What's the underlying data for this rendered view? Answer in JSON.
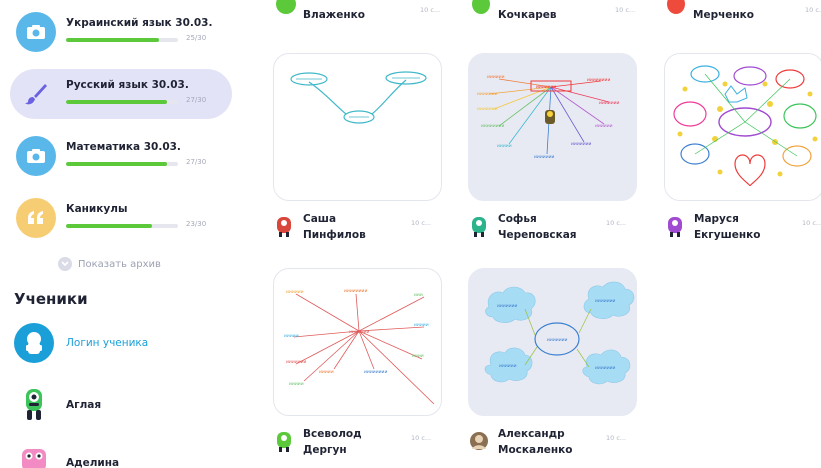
{
  "subjects": [
    {
      "title": "Украинский язык 30.03.",
      "count": "25/30",
      "progress": 0.83,
      "icon": "camera-icon",
      "color": "#5ab7ea",
      "active": false
    },
    {
      "title": "Русский язык 30.03.",
      "count": "27/30",
      "progress": 0.9,
      "icon": "brush-icon",
      "color": "#6b62e0",
      "active": true
    },
    {
      "title": "Математика 30.03.",
      "count": "27/30",
      "progress": 0.9,
      "icon": "camera-icon",
      "color": "#5ab7ea",
      "active": false
    },
    {
      "title": "Каникулы",
      "count": "23/30",
      "progress": 0.77,
      "icon": "quote-icon",
      "color": "#f3b33d",
      "active": false
    }
  ],
  "archive_label": "Показать архив",
  "students": {
    "heading": "Ученики",
    "items": [
      {
        "name": "Логин ученика",
        "type": "login"
      },
      {
        "name": "Аглая",
        "type": "monster-green"
      },
      {
        "name": "Аделина",
        "type": "monster-pink"
      }
    ]
  },
  "top_row": [
    {
      "name": "Влаженко",
      "time": "10 с...",
      "color": "#5cc93b"
    },
    {
      "name": "Кочкарев",
      "time": "10 с...",
      "color": "#5cc93b"
    },
    {
      "name": "Мерченко",
      "time": "10 с...",
      "color": "#ef4b3c"
    }
  ],
  "cards": [
    {
      "author_line1": "Саша",
      "author_line2": "Пинфилов",
      "time": "10 с...",
      "avatar_color": "#d9463c"
    },
    {
      "author_line1": "Софья",
      "author_line2": "Череповская",
      "time": "10 с...",
      "avatar_color": "#2bb38c"
    },
    {
      "author_line1": "Маруся",
      "author_line2": "Екгушенко",
      "time": "10 с...",
      "avatar_color": "#a04bd1"
    },
    {
      "author_line1": "Всеволод",
      "author_line2": "Дергун",
      "time": "10 с...",
      "avatar_color": "#5cc93b"
    },
    {
      "author_line1": "Александр",
      "author_line2": "Москаленко",
      "time": "10 с...",
      "avatar_color": "#8a6f52"
    }
  ]
}
